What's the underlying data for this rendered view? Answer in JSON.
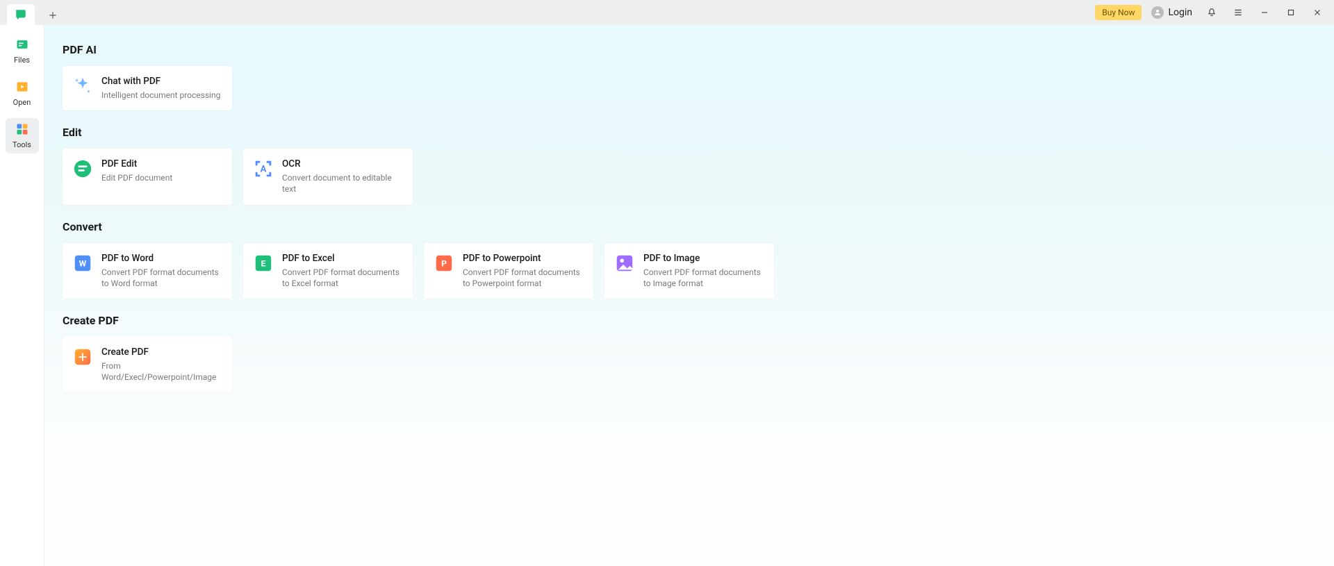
{
  "titlebar": {
    "buy_now": "Buy Now",
    "login": "Login"
  },
  "sidebar": {
    "items": [
      {
        "label": "Files"
      },
      {
        "label": "Open"
      },
      {
        "label": "Tools"
      }
    ]
  },
  "sections": {
    "pdf_ai": {
      "title": "PDF AI",
      "cards": [
        {
          "title": "Chat with PDF",
          "sub": "Intelligent document processing"
        }
      ]
    },
    "edit": {
      "title": "Edit",
      "cards": [
        {
          "title": "PDF Edit",
          "sub": "Edit PDF document"
        },
        {
          "title": "OCR",
          "sub": "Convert document to editable text"
        }
      ]
    },
    "convert": {
      "title": "Convert",
      "cards": [
        {
          "title": "PDF to Word",
          "sub": "Convert PDF format documents to Word format"
        },
        {
          "title": "PDF to Excel",
          "sub": "Convert PDF format documents to Excel format"
        },
        {
          "title": "PDF to Powerpoint",
          "sub": "Convert PDF format documents to Powerpoint format"
        },
        {
          "title": "PDF to Image",
          "sub": "Convert PDF format documents to Image format"
        }
      ]
    },
    "create_pdf": {
      "title": "Create PDF",
      "cards": [
        {
          "title": "Create PDF",
          "sub": "From Word/Execl/Powerpoint/Image"
        }
      ]
    }
  }
}
